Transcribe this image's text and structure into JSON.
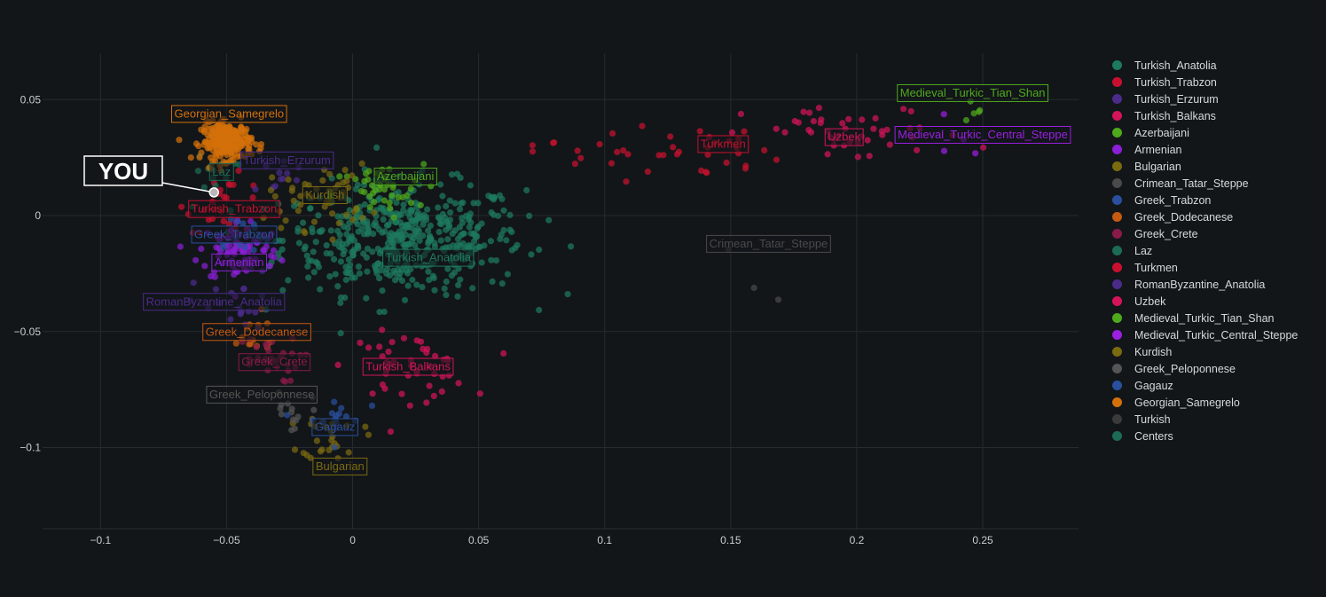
{
  "chart_data": {
    "type": "scatter",
    "xlim": [
      -0.123,
      0.288
    ],
    "ylim": [
      -0.135,
      0.07
    ],
    "x_ticks": [
      -0.1,
      -0.05,
      0,
      0.05,
      0.1,
      0.15,
      0.2,
      0.25
    ],
    "x_tick_labels": [
      "−0.1",
      "−0.05",
      "0",
      "0.05",
      "0.1",
      "0.15",
      "0.2",
      "0.25"
    ],
    "y_ticks": [
      -0.1,
      -0.05,
      0,
      0.05
    ],
    "y_tick_labels": [
      "−0.1",
      "−0.05",
      "0",
      "0.05"
    ],
    "grid": true,
    "legend_position": "right",
    "you": {
      "label": "YOU",
      "x": -0.055,
      "y": 0.01
    },
    "series": [
      {
        "name": "Turkish_Anatolia",
        "color": "#1d7a5e",
        "cx": 0.02,
        "cy": -0.01,
        "sx": 0.024,
        "sy": 0.012,
        "n": 480,
        "label": "Turkish_Anatolia",
        "label_x": 0.03,
        "label_y": -0.018
      },
      {
        "name": "Turkish_Trabzon",
        "color": "#c8102e",
        "cx": -0.05,
        "cy": 0.005,
        "sx": 0.008,
        "sy": 0.006,
        "n": 25,
        "label": "Turkish_Trabzon",
        "label_x": -0.047,
        "label_y": 0.003
      },
      {
        "name": "Turkish_Erzurum",
        "color": "#4b2b8a",
        "cx": -0.03,
        "cy": 0.018,
        "sx": 0.006,
        "sy": 0.005,
        "n": 12,
        "label": "Turkish_Erzurum",
        "label_x": -0.026,
        "label_y": 0.024
      },
      {
        "name": "Turkish_Balkans",
        "color": "#d4145a",
        "cx": 0.022,
        "cy": -0.065,
        "sx": 0.012,
        "sy": 0.007,
        "n": 45,
        "label": "Turkish_Balkans",
        "label_x": 0.022,
        "label_y": -0.065
      },
      {
        "name": "Azerbaijani",
        "color": "#4fa91c",
        "cx": 0.01,
        "cy": 0.01,
        "sx": 0.009,
        "sy": 0.006,
        "n": 45,
        "label": "Azerbaijani",
        "label_x": 0.021,
        "label_y": 0.017
      },
      {
        "name": "Armenian",
        "color": "#8b1fd6",
        "cx": -0.045,
        "cy": -0.015,
        "sx": 0.008,
        "sy": 0.007,
        "n": 90,
        "label": "Armenian",
        "label_x": -0.045,
        "label_y": -0.02
      },
      {
        "name": "Bulgarian",
        "color": "#7a6a10",
        "cx": -0.008,
        "cy": -0.095,
        "sx": 0.006,
        "sy": 0.005,
        "n": 25,
        "label": "Bulgarian",
        "label_x": -0.005,
        "label_y": -0.108
      },
      {
        "name": "Crimean_Tatar_Steppe",
        "color": "#4a4a4a",
        "cx": 0.15,
        "cy": -0.02,
        "sx": 0.02,
        "sy": 0.012,
        "n": 3,
        "label": "Crimean_Tatar_Steppe",
        "label_x": 0.165,
        "label_y": -0.012
      },
      {
        "name": "Greek_Trabzon",
        "color": "#2a4f9e",
        "cx": -0.045,
        "cy": -0.008,
        "sx": 0.006,
        "sy": 0.005,
        "n": 15,
        "label": "Greek_Trabzon",
        "label_x": -0.047,
        "label_y": -0.008
      },
      {
        "name": "Greek_Dodecanese",
        "color": "#c55a11",
        "cx": -0.04,
        "cy": -0.052,
        "sx": 0.006,
        "sy": 0.005,
        "n": 15,
        "label": "Greek_Dodecanese",
        "label_x": -0.038,
        "label_y": -0.05
      },
      {
        "name": "Greek_Crete",
        "color": "#8a1a4a",
        "cx": -0.035,
        "cy": -0.062,
        "sx": 0.007,
        "sy": 0.005,
        "n": 30,
        "label": "Greek_Crete",
        "label_x": -0.031,
        "label_y": -0.063
      },
      {
        "name": "Laz",
        "color": "#1d6b55",
        "cx": -0.054,
        "cy": 0.018,
        "sx": 0.004,
        "sy": 0.004,
        "n": 12,
        "label": "Laz",
        "label_x": -0.052,
        "label_y": 0.019
      },
      {
        "name": "Turkmen",
        "color": "#c8102e",
        "cx": 0.12,
        "cy": 0.028,
        "sx": 0.025,
        "sy": 0.006,
        "n": 40,
        "label": "Turkmen",
        "label_x": 0.147,
        "label_y": 0.031
      },
      {
        "name": "RomanByzantine_Anatolia",
        "color": "#4b2b8a",
        "cx": -0.047,
        "cy": -0.04,
        "sx": 0.008,
        "sy": 0.008,
        "n": 20,
        "label": "RomanByzantine_Anatolia",
        "label_x": -0.055,
        "label_y": -0.037
      },
      {
        "name": "Uzbek",
        "color": "#d4145a",
        "cx": 0.2,
        "cy": 0.035,
        "sx": 0.022,
        "sy": 0.006,
        "n": 45,
        "label": "Uzbek",
        "label_x": 0.195,
        "label_y": 0.034
      },
      {
        "name": "Medieval_Turkic_Tian_Shan",
        "color": "#4fa91c",
        "cx": 0.25,
        "cy": 0.045,
        "sx": 0.008,
        "sy": 0.006,
        "n": 5,
        "label": "Medieval_Turkic_Tian_Shan",
        "label_x": 0.246,
        "label_y": 0.053
      },
      {
        "name": "Medieval_Turkic_Central_Steppe",
        "color": "#9a1fe0",
        "cx": 0.245,
        "cy": 0.035,
        "sx": 0.01,
        "sy": 0.008,
        "n": 4,
        "label": "Medieval_Turkic_Central_Steppe",
        "label_x": 0.25,
        "label_y": 0.035
      },
      {
        "name": "Kurdish",
        "color": "#7a6a10",
        "cx": -0.013,
        "cy": 0.008,
        "sx": 0.01,
        "sy": 0.007,
        "n": 50,
        "label": "Kurdish",
        "label_x": -0.011,
        "label_y": 0.009
      },
      {
        "name": "Greek_Peloponnese",
        "color": "#555555",
        "cx": -0.025,
        "cy": -0.085,
        "sx": 0.006,
        "sy": 0.004,
        "n": 15,
        "label": "Greek_Peloponnese",
        "label_x": -0.036,
        "label_y": -0.077
      },
      {
        "name": "Gagauz",
        "color": "#2a4f9e",
        "cx": -0.008,
        "cy": -0.088,
        "sx": 0.006,
        "sy": 0.005,
        "n": 15,
        "label": "Gagauz",
        "label_x": -0.007,
        "label_y": -0.091
      },
      {
        "name": "Georgian_Samegrelo",
        "color": "#d4700a",
        "cx": -0.05,
        "cy": 0.032,
        "sx": 0.005,
        "sy": 0.004,
        "n": 240,
        "label": "Georgian_Samegrelo",
        "label_x": -0.049,
        "label_y": 0.044
      },
      {
        "name": "Turkish",
        "color": "#3a3a3a",
        "cx": 0,
        "cy": 0,
        "sx": 0,
        "sy": 0,
        "n": 0,
        "label": "",
        "label_x": 0,
        "label_y": 0
      },
      {
        "name": "Centers",
        "color": "#1d6b55",
        "cx": 0,
        "cy": 0,
        "sx": 0,
        "sy": 0,
        "n": 0,
        "label": "",
        "label_x": 0,
        "label_y": 0
      }
    ]
  }
}
